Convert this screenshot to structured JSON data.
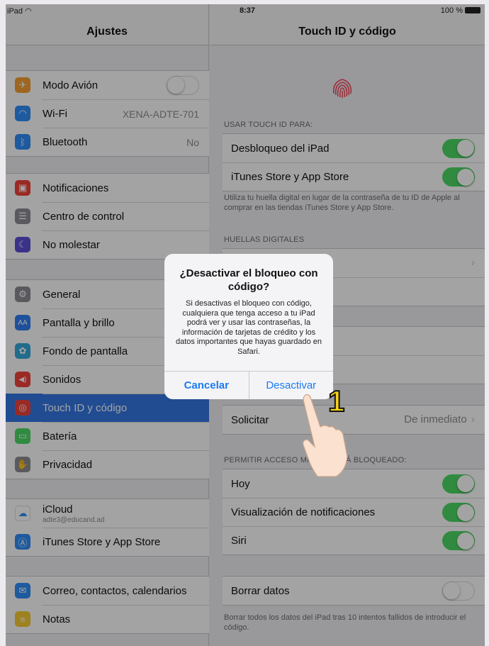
{
  "status_bar": {
    "device": "iPad",
    "time": "8:37",
    "battery": "100 %"
  },
  "master": {
    "title": "Ajustes",
    "group1": [
      {
        "icon": "airplane-icon",
        "color": "#f7a032",
        "label": "Modo Avión",
        "toggle": "off"
      },
      {
        "icon": "wifi-icon",
        "color": "#2f8ef7",
        "label": "Wi-Fi",
        "value": "XENA-ADTE-701"
      },
      {
        "icon": "bluetooth-icon",
        "color": "#2f8ef7",
        "label": "Bluetooth",
        "value": "No"
      }
    ],
    "group2": [
      {
        "icon": "notifications-icon",
        "color": "#f2423b",
        "label": "Notificaciones"
      },
      {
        "icon": "control-center-icon",
        "color": "#8e8e93",
        "label": "Centro de control"
      },
      {
        "icon": "moon-icon",
        "color": "#5b4fd6",
        "label": "No molestar"
      }
    ],
    "group3": [
      {
        "icon": "gear-icon",
        "color": "#8e8e93",
        "label": "General"
      },
      {
        "icon": "display-brightness-icon",
        "color": "#2f7ef2",
        "label": "Pantalla y brillo"
      },
      {
        "icon": "wallpaper-icon",
        "color": "#34aadc",
        "label": "Fondo de pantalla"
      },
      {
        "icon": "sound-icon",
        "color": "#f2423b",
        "label": "Sonidos"
      },
      {
        "icon": "fingerprint-icon",
        "color": "#f2423b",
        "label": "Touch ID y código",
        "selected": true
      },
      {
        "icon": "battery-icon",
        "color": "#4cd964",
        "label": "Batería"
      },
      {
        "icon": "hand-privacy-icon",
        "color": "#8e8e93",
        "label": "Privacidad"
      }
    ],
    "group4": [
      {
        "icon": "icloud-icon",
        "color": "#ffffff",
        "label": "iCloud",
        "sub": "adte3@educand.ad"
      },
      {
        "icon": "app-store-icon",
        "color": "#2f8ef7",
        "label": "iTunes Store y App Store"
      }
    ],
    "group5": [
      {
        "icon": "mail-icon",
        "color": "#2f8ef7",
        "label": "Correo, contactos, calendarios"
      },
      {
        "icon": "notes-icon",
        "color": "#f7cb32",
        "label": "Notas"
      }
    ]
  },
  "detail": {
    "title": "Touch ID y código",
    "use_header": "USAR TOUCH ID PARA:",
    "use_rows": [
      {
        "label": "Desbloqueo del iPad",
        "toggle": "on"
      },
      {
        "label": "iTunes Store y App Store",
        "toggle": "on"
      }
    ],
    "use_footer": "Utiliza tu huella digital en lugar de la contraseña de tu ID de Apple al comprar en las tiendas iTunes Store y App Store.",
    "fingerprints_header": "HUELLAS DIGITALES",
    "require_row": {
      "label": "Solicitar",
      "value": "De inmediato"
    },
    "locked_header": "PERMITIR ACCESO MIEN    S ESTÁ BLOQUEADO:",
    "locked_rows": [
      {
        "label": "Hoy",
        "toggle": "on"
      },
      {
        "label": "Visualización de notificaciones",
        "toggle": "on"
      },
      {
        "label": "Siri",
        "toggle": "on"
      }
    ],
    "erase_row": {
      "label": "Borrar datos",
      "toggle": "off"
    },
    "erase_footer": "Borrar todos los datos del iPad tras 10 intentos fallidos de introducir el código."
  },
  "alert": {
    "title": "¿Desactivar el bloqueo con código?",
    "message": "Si desactivas el bloqueo con código, cualquiera que tenga acceso a tu iPad podrá ver y usar las contraseñas, la información de tarjetas de crédito y los datos importantes que hayas guardado en Safari.",
    "cancel": "Cancelar",
    "confirm": "Desactivar"
  },
  "annotation": {
    "step": "1"
  }
}
